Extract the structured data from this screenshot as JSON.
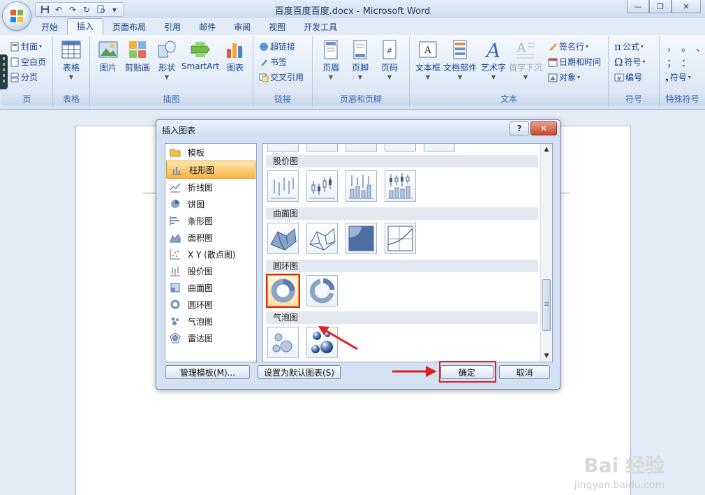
{
  "window": {
    "title": "百度百度百度.docx - Microsoft Word"
  },
  "tabs": [
    "开始",
    "插入",
    "页面布局",
    "引用",
    "邮件",
    "审阅",
    "视图",
    "开发工具"
  ],
  "active_tab": "插入",
  "ribbon": {
    "pages": {
      "label": "页",
      "items": [
        "封面",
        "空白页",
        "分页"
      ]
    },
    "tables": {
      "label": "表格",
      "button": "表格"
    },
    "illustrations": {
      "label": "插图",
      "buttons": [
        "图片",
        "剪贴画",
        "形状",
        "SmartArt",
        "图表"
      ]
    },
    "links": {
      "label": "链接",
      "items": [
        "超链接",
        "书签",
        "交叉引用"
      ]
    },
    "header_footer": {
      "label": "页眉和页脚",
      "buttons": [
        "页眉",
        "页脚",
        "页码"
      ]
    },
    "text": {
      "label": "文本",
      "buttons": [
        "文本框",
        "文档部件",
        "艺术字",
        "首字下沉"
      ],
      "items": [
        "签名行",
        "日期和时间",
        "对象"
      ]
    },
    "symbols": {
      "label": "符号",
      "items": [
        "公式",
        "符号",
        "编号"
      ]
    },
    "special": {
      "label": "特殊符号",
      "item": "符号"
    }
  },
  "dialog": {
    "title": "插入图表",
    "help": "?",
    "categories": [
      {
        "label": "模板",
        "icon": "folder-icon"
      },
      {
        "label": "柱形图",
        "icon": "column-chart-icon"
      },
      {
        "label": "折线图",
        "icon": "line-chart-icon"
      },
      {
        "label": "饼图",
        "icon": "pie-chart-icon"
      },
      {
        "label": "条形图",
        "icon": "bar-chart-icon"
      },
      {
        "label": "面积图",
        "icon": "area-chart-icon"
      },
      {
        "label": "X Y (散点图)",
        "icon": "scatter-chart-icon"
      },
      {
        "label": "股价图",
        "icon": "stock-chart-icon"
      },
      {
        "label": "曲面图",
        "icon": "surface-chart-icon"
      },
      {
        "label": "圆环图",
        "icon": "doughnut-chart-icon"
      },
      {
        "label": "气泡图",
        "icon": "bubble-chart-icon"
      },
      {
        "label": "雷达图",
        "icon": "radar-chart-icon"
      }
    ],
    "selected_category": "柱形图",
    "sections": {
      "stock": "股价图",
      "surface": "曲面图",
      "doughnut": "圆环图",
      "bubble": "气泡图"
    },
    "buttons": {
      "manage": "管理模板(M)...",
      "set_default": "设置为默认图表(S)",
      "ok": "确定",
      "cancel": "取消"
    }
  },
  "watermark": {
    "brand": "Bai 经验",
    "url": "jingyan.baidu.com"
  },
  "colors": {
    "accent": "#15428b",
    "highlight": "#e02020",
    "selected": "#f6b445"
  }
}
